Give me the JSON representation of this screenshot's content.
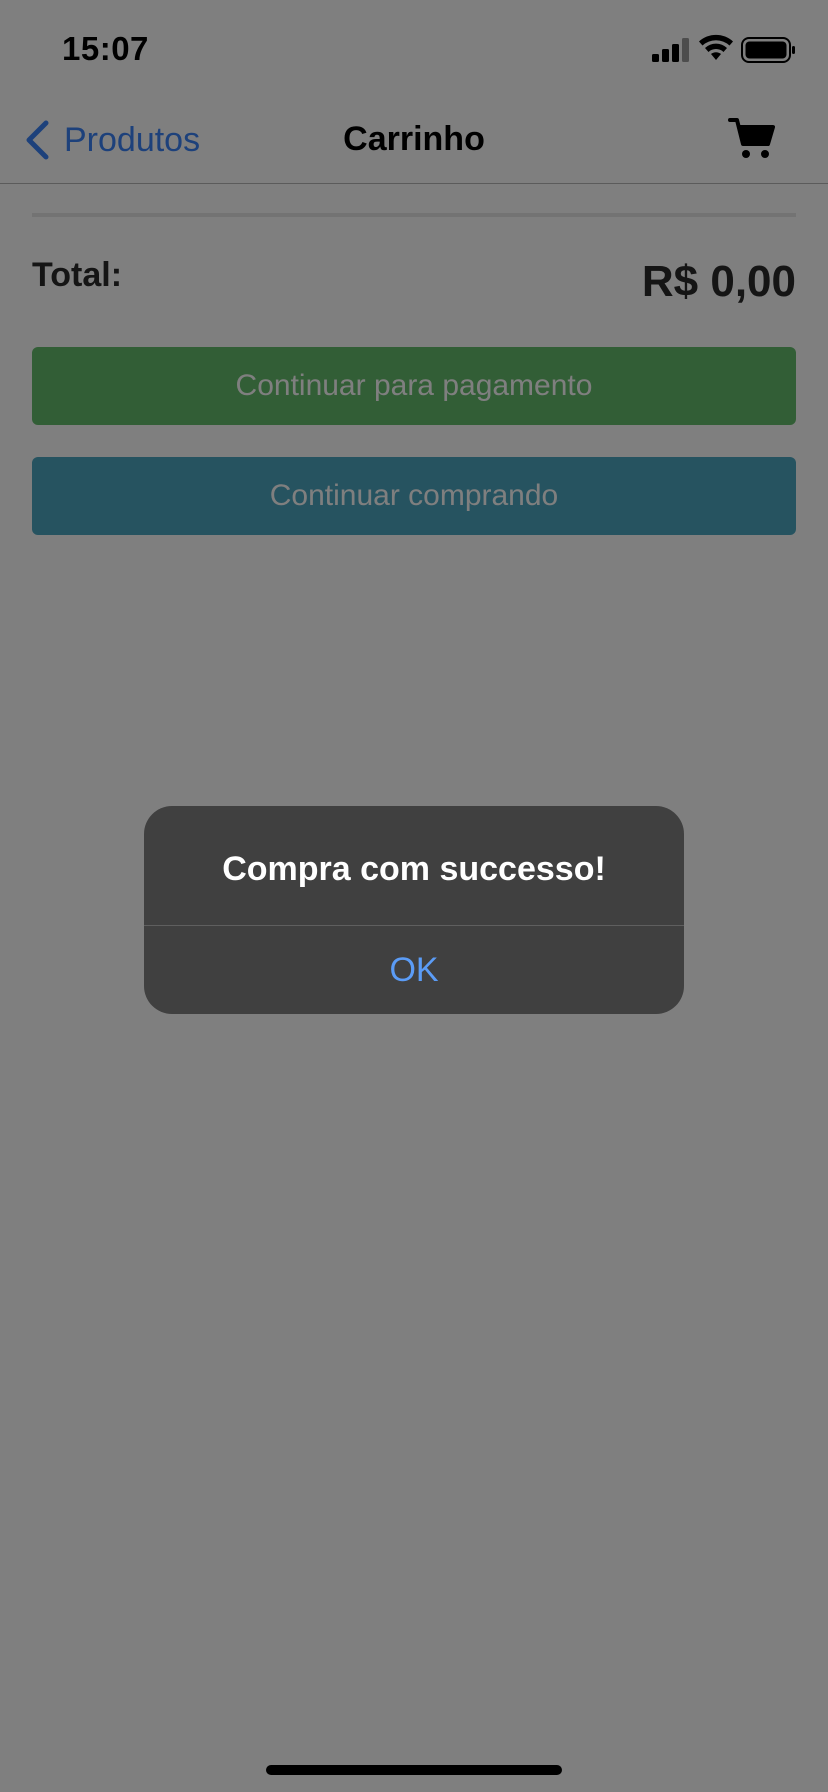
{
  "status_bar": {
    "time": "15:07"
  },
  "nav": {
    "back_label": "Produtos",
    "title": "Carrinho",
    "cart_icon": "shopping-cart-icon"
  },
  "cart": {
    "total_label": "Total:",
    "total_value": "R$ 0,00",
    "pay_button": "Continuar para pagamento",
    "continue_button": "Continuar comprando"
  },
  "alert": {
    "title": "Compra com successo!",
    "ok_label": "OK"
  },
  "colors": {
    "accent": "#3b82f6",
    "pay_button": "#64bc6c",
    "continue_button": "#4da7c0",
    "alert_bg": "#404040",
    "alert_ok": "#5b9cf6"
  }
}
